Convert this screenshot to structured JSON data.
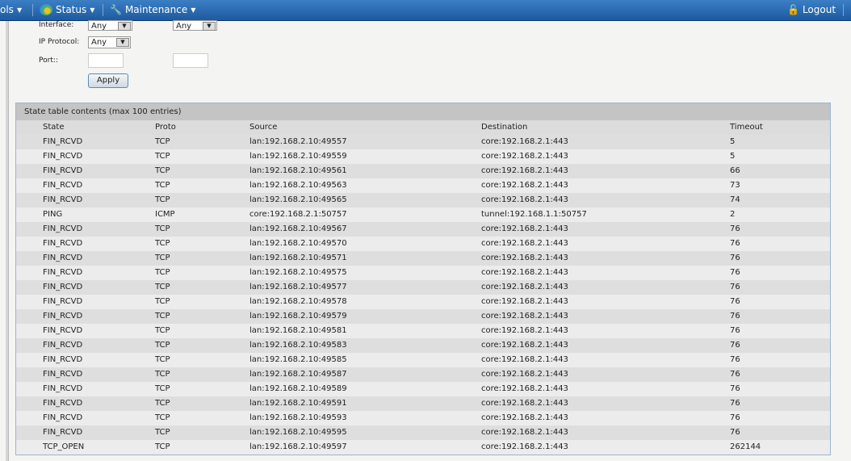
{
  "nav": {
    "tools": "ols",
    "status": "Status",
    "maintenance": "Maintenance",
    "logout": "Logout"
  },
  "filters": {
    "interface_label": "Interface:",
    "interface_src": "Any",
    "interface_dst": "Any",
    "protocol_label": "IP Protocol:",
    "protocol": "Any",
    "port_label": "Port::",
    "port_src": "",
    "port_dst": "",
    "apply": "Apply"
  },
  "table": {
    "title": "State table contents (max 100 entries)",
    "headers": [
      "State",
      "Proto",
      "Source",
      "Destination",
      "Timeout"
    ],
    "rows": [
      [
        "FIN_RCVD",
        "TCP",
        "lan:192.168.2.10:49557",
        "core:192.168.2.1:443",
        "5"
      ],
      [
        "FIN_RCVD",
        "TCP",
        "lan:192.168.2.10:49559",
        "core:192.168.2.1:443",
        "5"
      ],
      [
        "FIN_RCVD",
        "TCP",
        "lan:192.168.2.10:49561",
        "core:192.168.2.1:443",
        "66"
      ],
      [
        "FIN_RCVD",
        "TCP",
        "lan:192.168.2.10:49563",
        "core:192.168.2.1:443",
        "73"
      ],
      [
        "FIN_RCVD",
        "TCP",
        "lan:192.168.2.10:49565",
        "core:192.168.2.1:443",
        "74"
      ],
      [
        "PING",
        "ICMP",
        "core:192.168.2.1:50757",
        "tunnel:192.168.1.1:50757",
        "2"
      ],
      [
        "FIN_RCVD",
        "TCP",
        "lan:192.168.2.10:49567",
        "core:192.168.2.1:443",
        "76"
      ],
      [
        "FIN_RCVD",
        "TCP",
        "lan:192.168.2.10:49570",
        "core:192.168.2.1:443",
        "76"
      ],
      [
        "FIN_RCVD",
        "TCP",
        "lan:192.168.2.10:49571",
        "core:192.168.2.1:443",
        "76"
      ],
      [
        "FIN_RCVD",
        "TCP",
        "lan:192.168.2.10:49575",
        "core:192.168.2.1:443",
        "76"
      ],
      [
        "FIN_RCVD",
        "TCP",
        "lan:192.168.2.10:49577",
        "core:192.168.2.1:443",
        "76"
      ],
      [
        "FIN_RCVD",
        "TCP",
        "lan:192.168.2.10:49578",
        "core:192.168.2.1:443",
        "76"
      ],
      [
        "FIN_RCVD",
        "TCP",
        "lan:192.168.2.10:49579",
        "core:192.168.2.1:443",
        "76"
      ],
      [
        "FIN_RCVD",
        "TCP",
        "lan:192.168.2.10:49581",
        "core:192.168.2.1:443",
        "76"
      ],
      [
        "FIN_RCVD",
        "TCP",
        "lan:192.168.2.10:49583",
        "core:192.168.2.1:443",
        "76"
      ],
      [
        "FIN_RCVD",
        "TCP",
        "lan:192.168.2.10:49585",
        "core:192.168.2.1:443",
        "76"
      ],
      [
        "FIN_RCVD",
        "TCP",
        "lan:192.168.2.10:49587",
        "core:192.168.2.1:443",
        "76"
      ],
      [
        "FIN_RCVD",
        "TCP",
        "lan:192.168.2.10:49589",
        "core:192.168.2.1:443",
        "76"
      ],
      [
        "FIN_RCVD",
        "TCP",
        "lan:192.168.2.10:49591",
        "core:192.168.2.1:443",
        "76"
      ],
      [
        "FIN_RCVD",
        "TCP",
        "lan:192.168.2.10:49593",
        "core:192.168.2.1:443",
        "76"
      ],
      [
        "FIN_RCVD",
        "TCP",
        "lan:192.168.2.10:49595",
        "core:192.168.2.1:443",
        "76"
      ],
      [
        "TCP_OPEN",
        "TCP",
        "lan:192.168.2.10:49597",
        "core:192.168.2.1:443",
        "262144"
      ]
    ]
  }
}
